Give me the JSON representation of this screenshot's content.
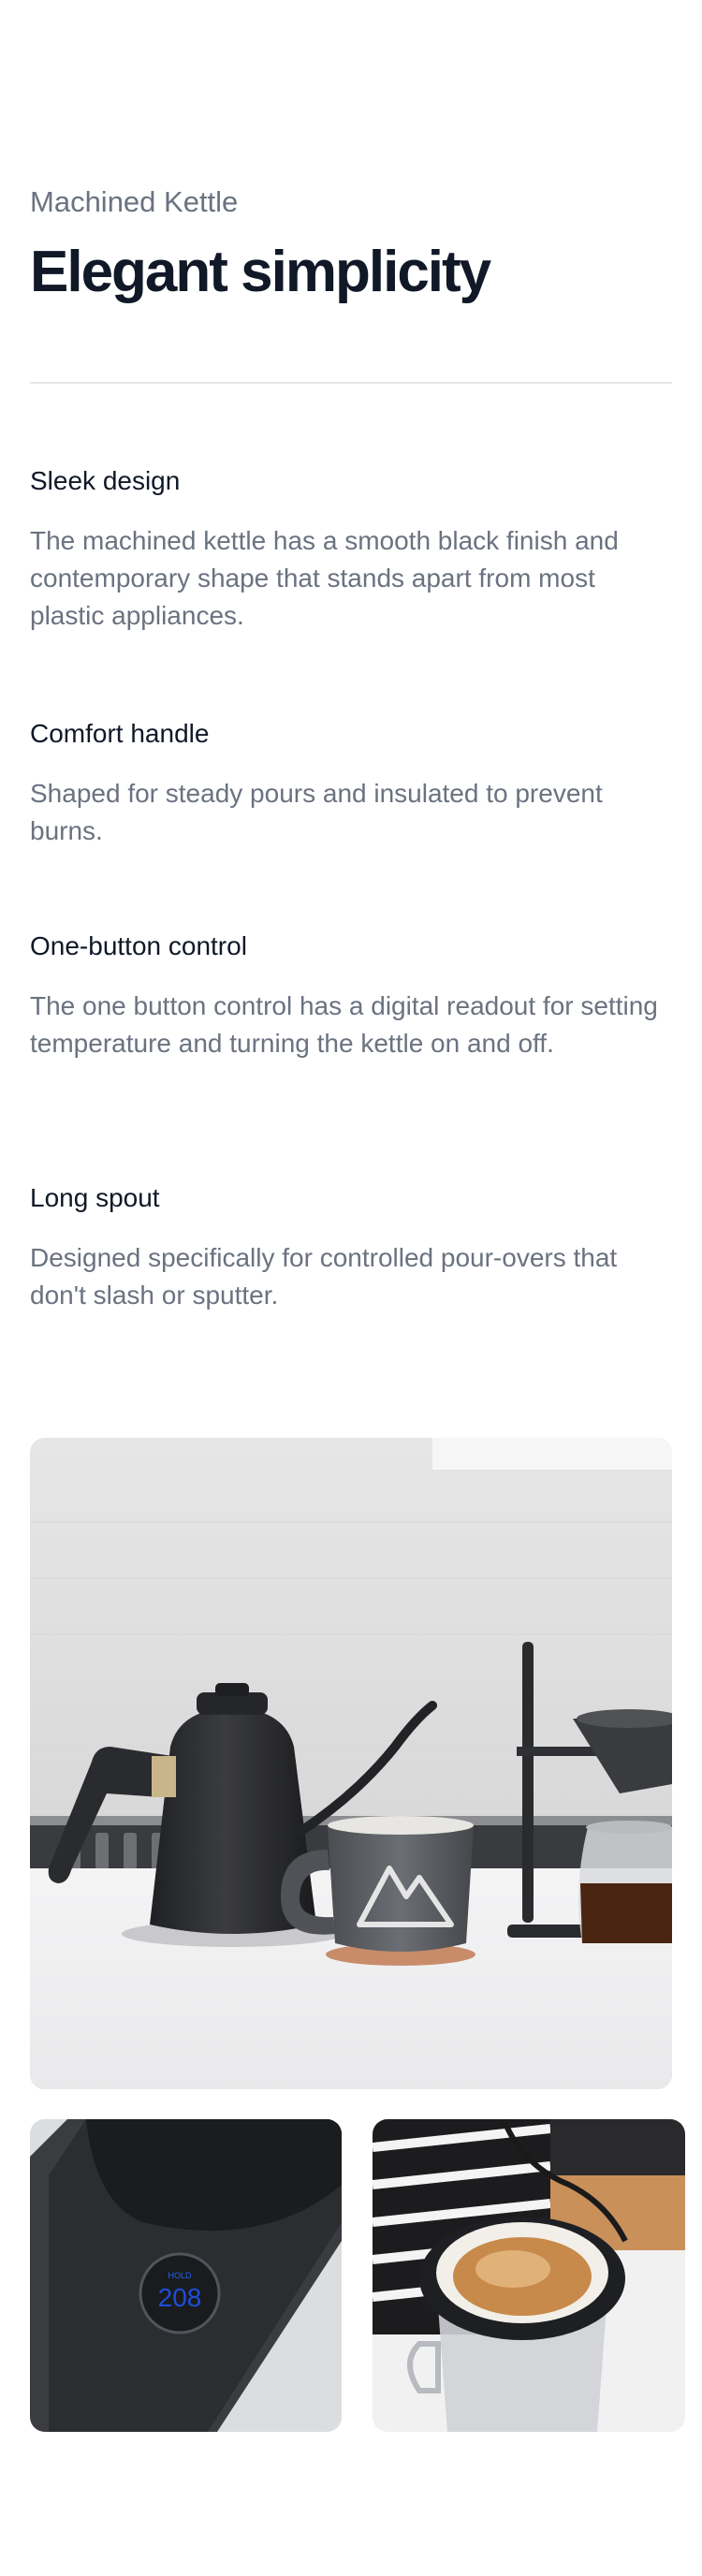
{
  "header": {
    "eyebrow": "Machined Kettle",
    "title": "Elegant simplicity"
  },
  "features": [
    {
      "title": "Sleek design",
      "description": "The machined kettle has a smooth black finish and contemporary shape that stands apart from most plastic appliances."
    },
    {
      "title": "Comfort handle",
      "description": "Shaped for steady pours and insulated to prevent burns."
    },
    {
      "title": "One-button control",
      "description": "The one button control has a digital readout for setting temperature and turning the kettle on and off."
    },
    {
      "title": "Long spout",
      "description": "Designed specifically for controlled pour-overs that don't slash or sputter."
    }
  ],
  "images": {
    "main": "kettle-with-mug-and-pour-over-photo",
    "detail_left": "kettle-base-digital-readout-photo",
    "detail_right": "pour-over-coffee-filter-photo",
    "readout": {
      "unit": "HOLD",
      "value": "208"
    }
  },
  "colors": {
    "heading": "#111827",
    "body": "#6b7280",
    "divider": "#e5e7eb",
    "readout": "#2563eb"
  }
}
